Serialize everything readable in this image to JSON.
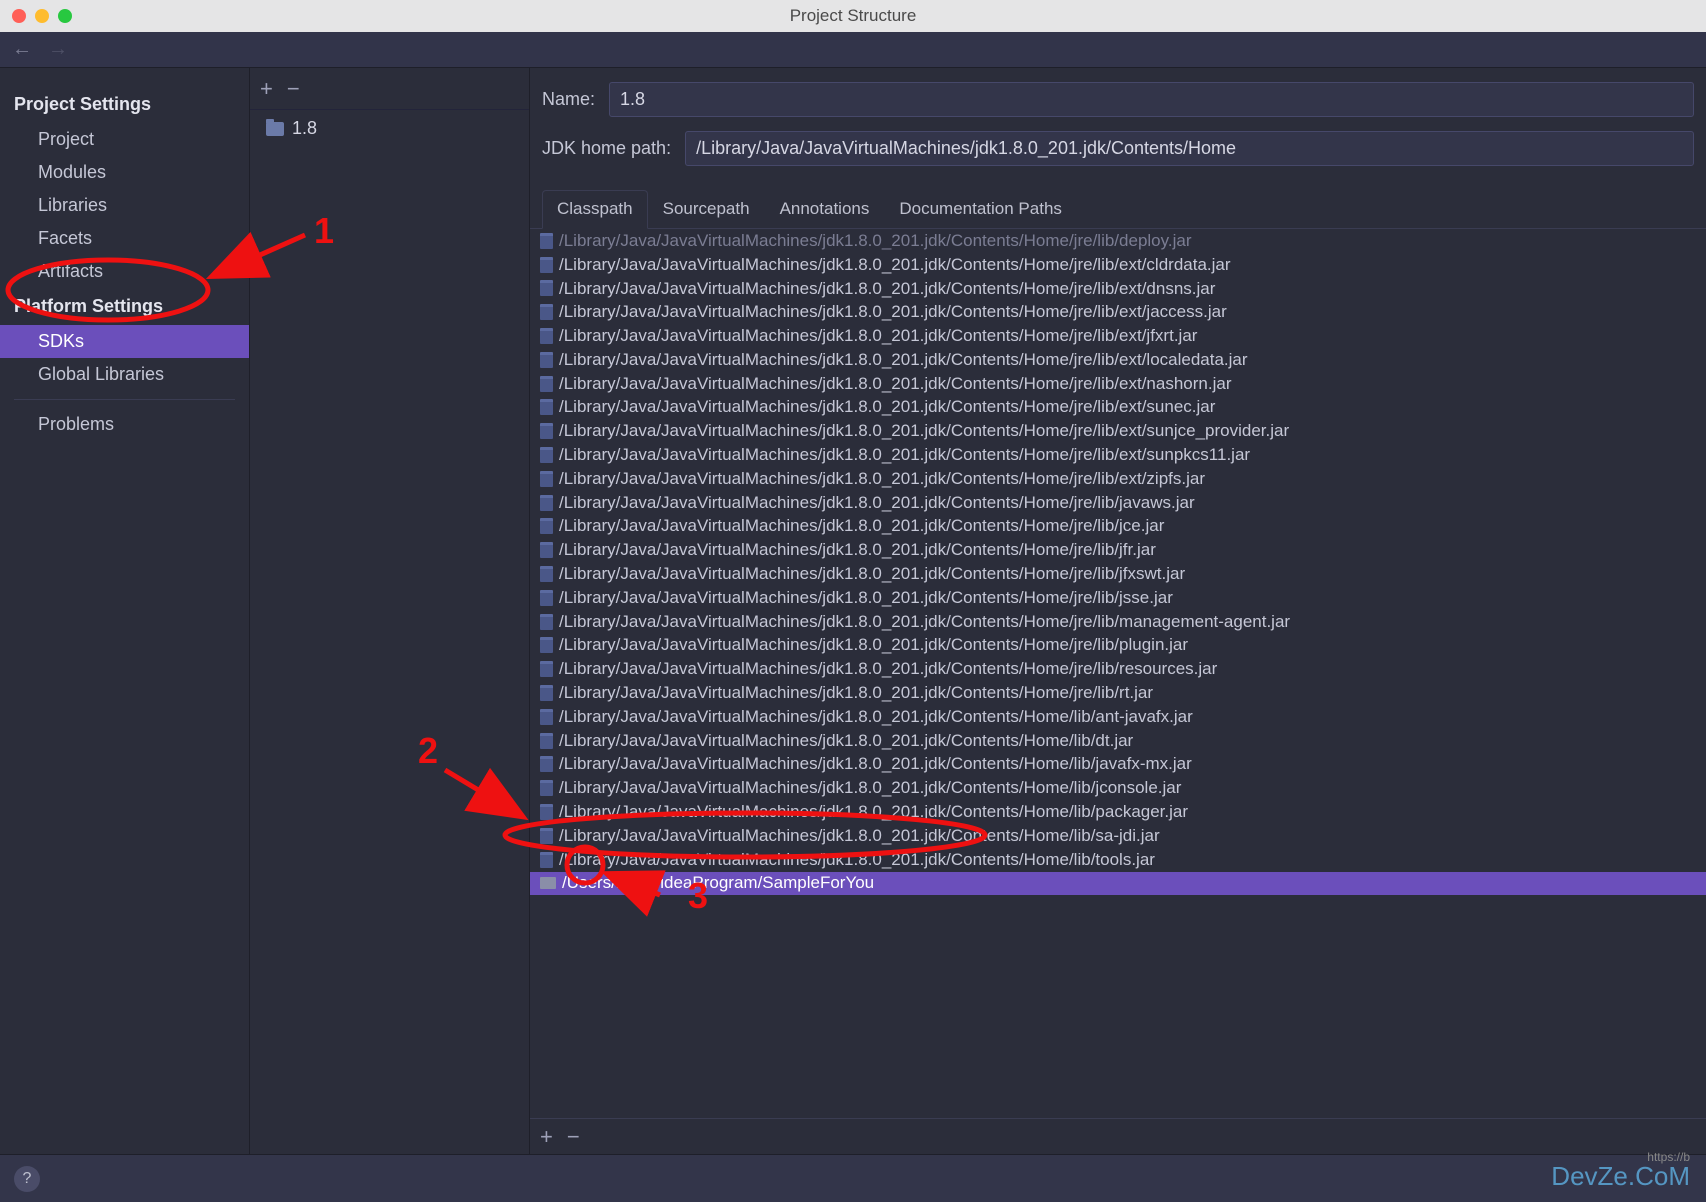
{
  "window": {
    "title": "Project Structure"
  },
  "sidebar": {
    "section1": {
      "header": "Project Settings",
      "items": [
        "Project",
        "Modules",
        "Libraries",
        "Facets",
        "Artifacts"
      ]
    },
    "section2": {
      "header": "Platform Settings",
      "items": [
        "SDKs",
        "Global Libraries"
      ]
    },
    "section3": {
      "items": [
        "Problems"
      ]
    }
  },
  "mid": {
    "item": "1.8"
  },
  "detail": {
    "name_label": "Name:",
    "name_value": "1.8",
    "path_label": "JDK home path:",
    "path_value": "/Library/Java/JavaVirtualMachines/jdk1.8.0_201.jdk/Contents/Home",
    "tabs": [
      "Classpath",
      "Sourcepath",
      "Annotations",
      "Documentation Paths"
    ],
    "classpath": [
      {
        "t": "jar",
        "cut": true,
        "p": "/Library/Java/JavaVirtualMachines/jdk1.8.0_201.jdk/Contents/Home/jre/lib/deploy.jar"
      },
      {
        "t": "jar",
        "p": "/Library/Java/JavaVirtualMachines/jdk1.8.0_201.jdk/Contents/Home/jre/lib/ext/cldrdata.jar"
      },
      {
        "t": "jar",
        "p": "/Library/Java/JavaVirtualMachines/jdk1.8.0_201.jdk/Contents/Home/jre/lib/ext/dnsns.jar"
      },
      {
        "t": "jar",
        "p": "/Library/Java/JavaVirtualMachines/jdk1.8.0_201.jdk/Contents/Home/jre/lib/ext/jaccess.jar"
      },
      {
        "t": "jar",
        "p": "/Library/Java/JavaVirtualMachines/jdk1.8.0_201.jdk/Contents/Home/jre/lib/ext/jfxrt.jar"
      },
      {
        "t": "jar",
        "p": "/Library/Java/JavaVirtualMachines/jdk1.8.0_201.jdk/Contents/Home/jre/lib/ext/localedata.jar"
      },
      {
        "t": "jar",
        "p": "/Library/Java/JavaVirtualMachines/jdk1.8.0_201.jdk/Contents/Home/jre/lib/ext/nashorn.jar"
      },
      {
        "t": "jar",
        "p": "/Library/Java/JavaVirtualMachines/jdk1.8.0_201.jdk/Contents/Home/jre/lib/ext/sunec.jar"
      },
      {
        "t": "jar",
        "p": "/Library/Java/JavaVirtualMachines/jdk1.8.0_201.jdk/Contents/Home/jre/lib/ext/sunjce_provider.jar"
      },
      {
        "t": "jar",
        "p": "/Library/Java/JavaVirtualMachines/jdk1.8.0_201.jdk/Contents/Home/jre/lib/ext/sunpkcs11.jar"
      },
      {
        "t": "jar",
        "p": "/Library/Java/JavaVirtualMachines/jdk1.8.0_201.jdk/Contents/Home/jre/lib/ext/zipfs.jar"
      },
      {
        "t": "jar",
        "p": "/Library/Java/JavaVirtualMachines/jdk1.8.0_201.jdk/Contents/Home/jre/lib/javaws.jar"
      },
      {
        "t": "jar",
        "p": "/Library/Java/JavaVirtualMachines/jdk1.8.0_201.jdk/Contents/Home/jre/lib/jce.jar"
      },
      {
        "t": "jar",
        "p": "/Library/Java/JavaVirtualMachines/jdk1.8.0_201.jdk/Contents/Home/jre/lib/jfr.jar"
      },
      {
        "t": "jar",
        "p": "/Library/Java/JavaVirtualMachines/jdk1.8.0_201.jdk/Contents/Home/jre/lib/jfxswt.jar"
      },
      {
        "t": "jar",
        "p": "/Library/Java/JavaVirtualMachines/jdk1.8.0_201.jdk/Contents/Home/jre/lib/jsse.jar"
      },
      {
        "t": "jar",
        "p": "/Library/Java/JavaVirtualMachines/jdk1.8.0_201.jdk/Contents/Home/jre/lib/management-agent.jar"
      },
      {
        "t": "jar",
        "p": "/Library/Java/JavaVirtualMachines/jdk1.8.0_201.jdk/Contents/Home/jre/lib/plugin.jar"
      },
      {
        "t": "jar",
        "p": "/Library/Java/JavaVirtualMachines/jdk1.8.0_201.jdk/Contents/Home/jre/lib/resources.jar"
      },
      {
        "t": "jar",
        "p": "/Library/Java/JavaVirtualMachines/jdk1.8.0_201.jdk/Contents/Home/jre/lib/rt.jar"
      },
      {
        "t": "jar",
        "p": "/Library/Java/JavaVirtualMachines/jdk1.8.0_201.jdk/Contents/Home/lib/ant-javafx.jar"
      },
      {
        "t": "jar",
        "p": "/Library/Java/JavaVirtualMachines/jdk1.8.0_201.jdk/Contents/Home/lib/dt.jar"
      },
      {
        "t": "jar",
        "p": "/Library/Java/JavaVirtualMachines/jdk1.8.0_201.jdk/Contents/Home/lib/javafx-mx.jar"
      },
      {
        "t": "jar",
        "p": "/Library/Java/JavaVirtualMachines/jdk1.8.0_201.jdk/Contents/Home/lib/jconsole.jar"
      },
      {
        "t": "jar",
        "p": "/Library/Java/JavaVirtualMachines/jdk1.8.0_201.jdk/Contents/Home/lib/packager.jar"
      },
      {
        "t": "jar",
        "p": "/Library/Java/JavaVirtualMachines/jdk1.8.0_201.jdk/Contents/Home/lib/sa-jdi.jar"
      },
      {
        "t": "jar",
        "p": "/Library/Java/JavaVirtualMachines/jdk1.8.0_201.jdk/Contents/Home/lib/tools.jar"
      },
      {
        "t": "folder",
        "sel": true,
        "p": "/Users/Dash/ideaProgram/SampleForYou"
      }
    ]
  },
  "annotations": {
    "n1": "1",
    "n2": "2",
    "n3": "3"
  },
  "watermark": {
    "brand": "DevZe.CoM",
    "url": "https://b"
  }
}
